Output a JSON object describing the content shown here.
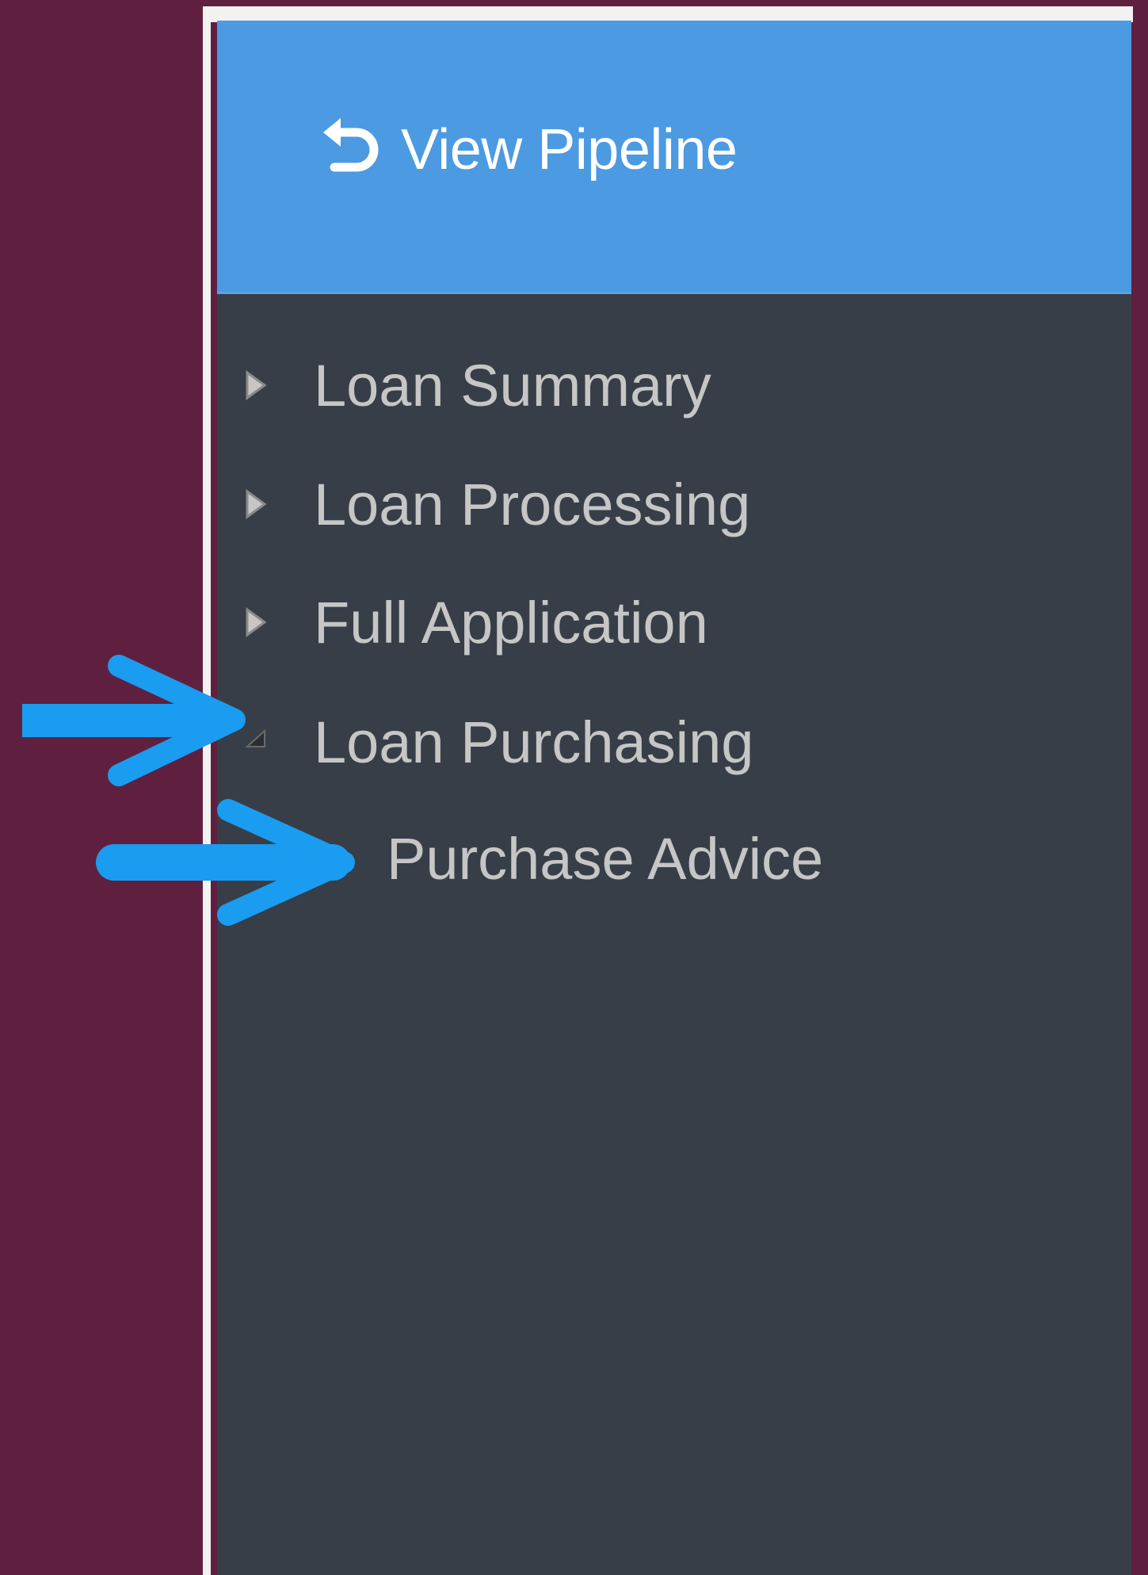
{
  "header": {
    "back_label": "View Pipeline",
    "icon": "undo-arrow-icon",
    "background_color": "#4b9ae2"
  },
  "nav": {
    "items": [
      {
        "label": "Loan Summary",
        "icon": "caret-right-icon",
        "expanded": false
      },
      {
        "label": "Loan Processing",
        "icon": "caret-right-icon",
        "expanded": false
      },
      {
        "label": "Full Application",
        "icon": "caret-right-icon",
        "expanded": false
      },
      {
        "label": "Loan Purchasing",
        "icon": "caret-down-icon",
        "expanded": true,
        "children": [
          {
            "label": "Purchase Advice"
          }
        ]
      }
    ]
  },
  "colors": {
    "page_background": "#5f2040",
    "panel_background": "#373e47",
    "nav_text": "#c6c6c6",
    "annotation_arrow": "#1a9cf0"
  }
}
